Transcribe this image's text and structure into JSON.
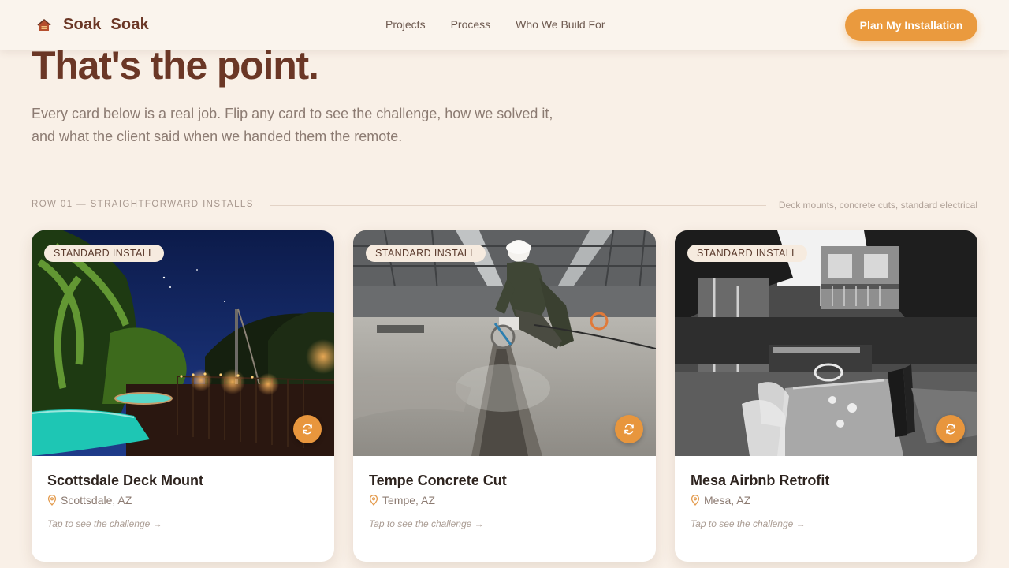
{
  "brand": {
    "name": "Soak  Soak",
    "logo_icon": "house-icon"
  },
  "nav": {
    "items": [
      "Projects",
      "Process",
      "Who We Build For"
    ]
  },
  "cta": {
    "label": "Plan My Installation"
  },
  "hero": {
    "title": "That's the point.",
    "subtitle": "Every card below is a real job. Flip any card to see the challenge, how we solved it, and what the client said when we handed them the remote."
  },
  "row": {
    "label": "ROW 01 — STRAIGHTFORWARD INSTALLS",
    "note": "Deck mounts, concrete cuts, standard electrical"
  },
  "cards": [
    {
      "badge": "STANDARD INSTALL",
      "title": "Scottsdale Deck Mount",
      "location": "Scottsdale, AZ",
      "hint": "Tap to see the challenge →"
    },
    {
      "badge": "STANDARD INSTALL",
      "title": "Tempe Concrete Cut",
      "location": "Tempe, AZ",
      "hint": "Tap to see the challenge →"
    },
    {
      "badge": "STANDARD INSTALL",
      "title": "Mesa Airbnb Retrofit",
      "location": "Mesa, AZ",
      "hint": "Tap to see the challenge →"
    }
  ],
  "colors": {
    "accent": "#ea9a3e",
    "brand": "#6b3726",
    "background": "#f9f0e7"
  }
}
